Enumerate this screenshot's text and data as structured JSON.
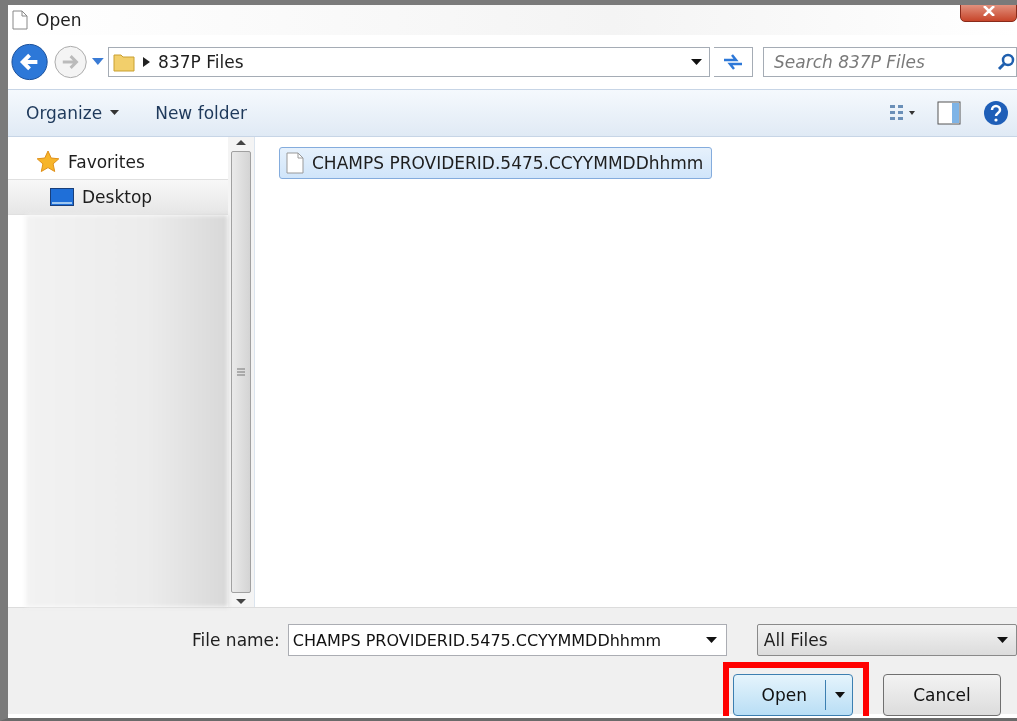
{
  "window": {
    "title": "Open"
  },
  "address": {
    "path": "837P Files"
  },
  "search": {
    "placeholder": "Search 837P Files"
  },
  "toolbar": {
    "buttons": [
      {
        "label": "Organize",
        "dropdown": true
      },
      {
        "label": "New folder",
        "dropdown": false
      }
    ]
  },
  "sidebar": {
    "items": [
      {
        "label": "Favorites",
        "kind": "group",
        "selected": false
      },
      {
        "label": "Desktop",
        "kind": "item",
        "selected": true
      }
    ]
  },
  "files": [
    {
      "name": "CHAMPS PROVIDERID.5475.CCYYMMDDhhmm",
      "selected": true
    }
  ],
  "file_name": {
    "label": "File name:",
    "value": "CHAMPS PROVIDERID.5475.CCYYMMDDhhmm"
  },
  "file_type": {
    "value": "All Files"
  },
  "buttons": [
    {
      "label": "Open",
      "kind": "split",
      "highlighted": true
    },
    {
      "label": "Cancel",
      "kind": "plain",
      "highlighted": false
    }
  ]
}
